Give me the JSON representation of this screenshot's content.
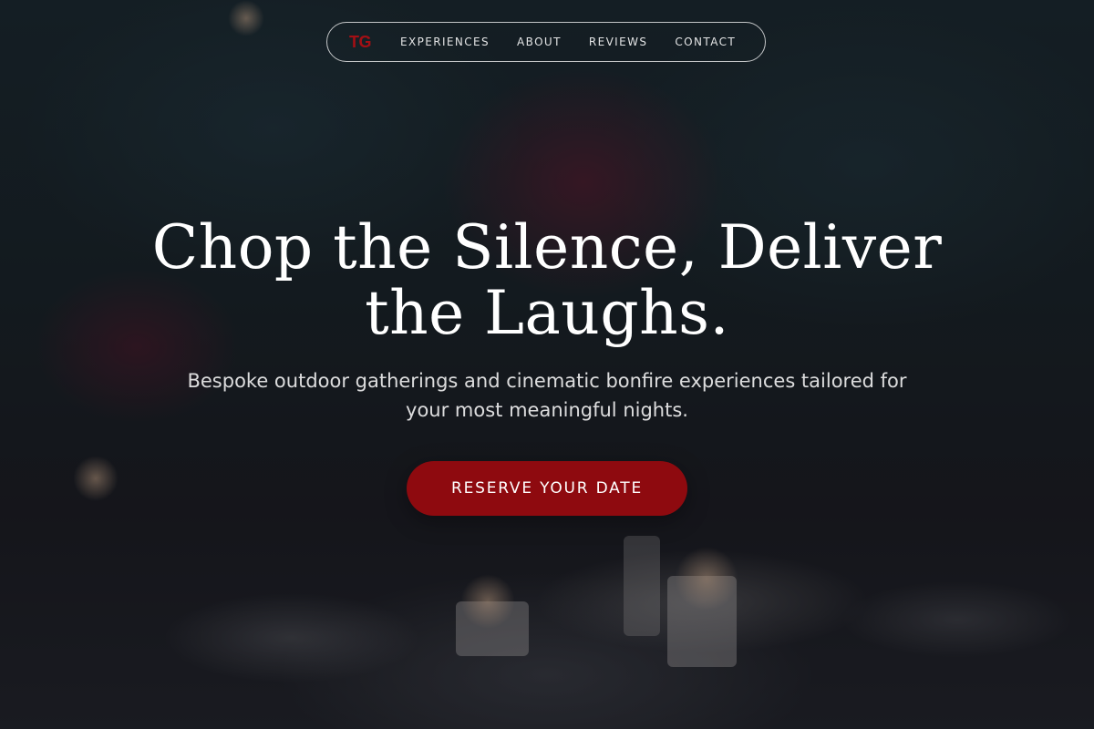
{
  "nav": {
    "logo": "TG",
    "links": [
      "EXPERIENCES",
      "ABOUT",
      "REVIEWS",
      "CONTACT"
    ]
  },
  "hero": {
    "headline_line1": "Chop the Silence, Deliver",
    "headline_line2": "the Laughs.",
    "subheadline_line1": "Bespoke outdoor gatherings and cinematic bonfire experiences tailored for",
    "subheadline_line2": "your most meaningful nights.",
    "cta_label": "RESERVE YOUR DATE"
  },
  "colors": {
    "accent": "#8e0a0f",
    "logo": "#a40f14",
    "text": "#ffffff"
  }
}
